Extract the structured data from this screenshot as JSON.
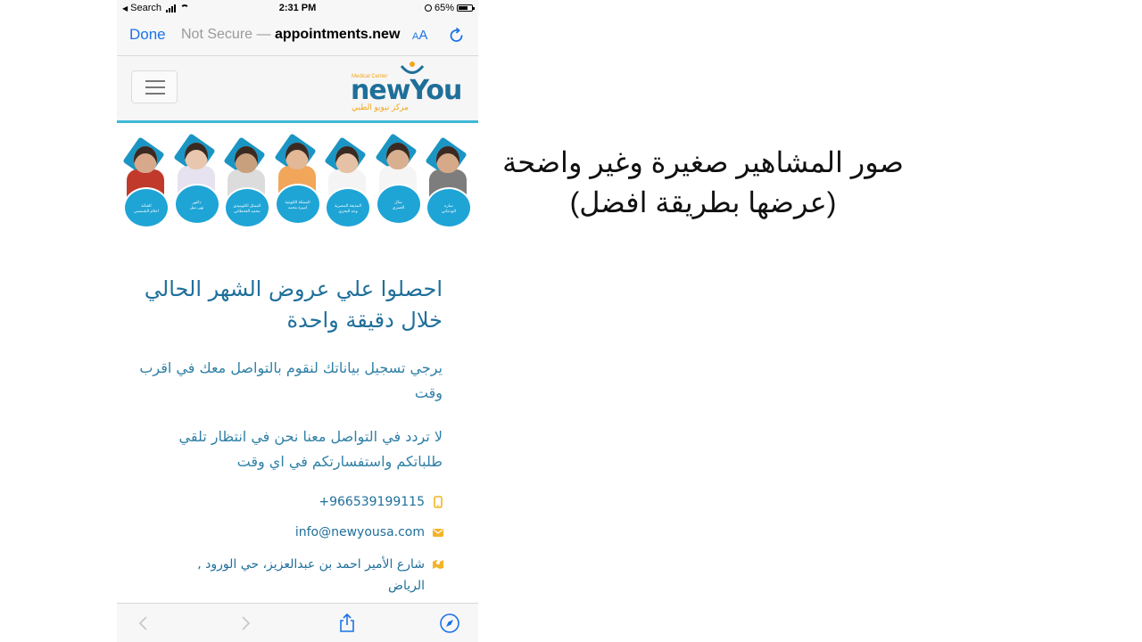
{
  "status_bar": {
    "back_label": "Search",
    "time": "2:31 PM",
    "battery": "65%"
  },
  "browser": {
    "done_label": "Done",
    "security_text": "Not Secure —",
    "domain": "appointments.new",
    "text_size_label": "AA",
    "accent_color": "#1a73e8"
  },
  "site": {
    "logo": {
      "small_text": "Medical Center",
      "word": "newYou",
      "arabic": "مركز نيويو الطبي"
    },
    "celebrities": [
      {
        "caption": "الفنانة\nاحلام الشمسي",
        "top_color": "#c0392b",
        "skin": "#d7a98a"
      },
      {
        "caption": "دكتور\nنهى نبيل",
        "top_color": "#e7e2f0",
        "skin": "#e9c7ae"
      },
      {
        "caption": "الممثل الكوميدي\nمحمد القحطاني",
        "top_color": "#dcdcdc",
        "skin": "#c9a07e"
      },
      {
        "caption": "الممثلة الكويتية\nاميرة محمد",
        "top_color": "#f2a65a",
        "skin": "#e2b896"
      },
      {
        "caption": "المذيعة المصرية\nوعد البحري",
        "top_color": "#f4f4f4",
        "skin": "#e5c1a5"
      },
      {
        "caption": "منال\nالعمري",
        "top_color": "#f5f5f5",
        "skin": "#d9b08f"
      },
      {
        "caption": "ساره\nالودعاني",
        "top_color": "#7d7d7d",
        "skin": "#d6a988"
      }
    ],
    "heading": "احصلوا علي عروض الشهر الحالي خلال دقيقة واحدة",
    "paragraph1": "يرجي تسجيل بياناتك لنقوم بالتواصل معك في اقرب وقت",
    "paragraph2": "لا تردد في التواصل معنا نحن في انتظار تلقي طلباتكم واستفسارتكم في اي وقت",
    "contact": {
      "phone": "+966539199115",
      "email": "info@newyousa.com",
      "address": "شارع الأمير احمد بن عبدالعزيز، حي الورود , الرياض",
      "icon_color": "#f3b32a"
    }
  },
  "annotation": "صور المشاهير صغيرة وغير واضحة (عرضها بطريقة افضل)"
}
